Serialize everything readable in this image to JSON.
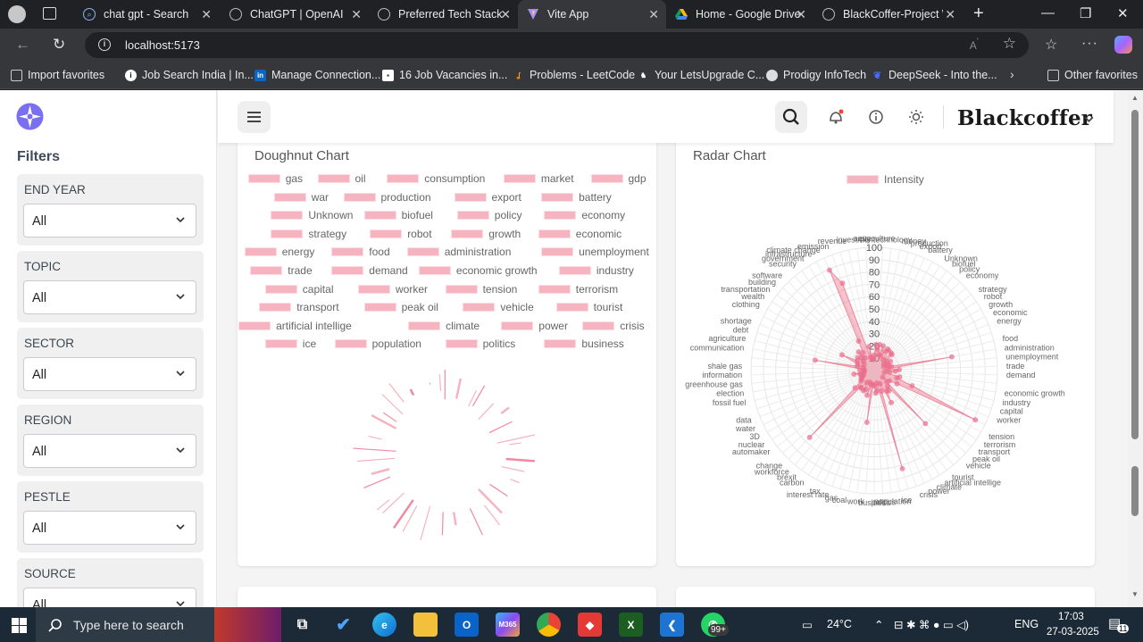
{
  "browser": {
    "tabs": [
      {
        "title": "chat gpt - Search",
        "active": false
      },
      {
        "title": "ChatGPT | OpenAI",
        "active": false
      },
      {
        "title": "Preferred Tech Stack",
        "active": false
      },
      {
        "title": "Vite App",
        "active": true
      },
      {
        "title": "Home - Google Drive",
        "active": false
      },
      {
        "title": "BlackCoffer-Project W",
        "active": false
      }
    ],
    "url": "localhost:5173",
    "favorites": [
      {
        "label": "Import favorites"
      },
      {
        "label": "Job Search India | In..."
      },
      {
        "label": "Manage Connection..."
      },
      {
        "label": "16 Job Vacancies in..."
      },
      {
        "label": "Problems - LeetCode"
      },
      {
        "label": "Your LetsUpgrade C..."
      },
      {
        "label": "Prodigy InfoTech"
      },
      {
        "label": "DeepSeek - Into the..."
      },
      {
        "label": "Other favorites"
      }
    ]
  },
  "sidebar": {
    "title": "Filters",
    "filters": [
      {
        "label": "END YEAR",
        "value": "All"
      },
      {
        "label": "TOPIC",
        "value": "All"
      },
      {
        "label": "SECTOR",
        "value": "All"
      },
      {
        "label": "REGION",
        "value": "All"
      },
      {
        "label": "PESTLE",
        "value": "All"
      },
      {
        "label": "SOURCE",
        "value": "All"
      }
    ]
  },
  "header": {
    "brand": "Blackcoffer"
  },
  "colors": {
    "accent": "#f6b3c0",
    "accent_stroke": "#e8778f",
    "logo": "#7a6ff0"
  },
  "chart_data": [
    {
      "type": "pie",
      "title": "Doughnut Chart",
      "categories": [
        "gas",
        "oil",
        "consumption",
        "market",
        "gdp",
        "war",
        "production",
        "export",
        "battery",
        "Unknown",
        "biofuel",
        "policy",
        "economy",
        "strategy",
        "robot",
        "growth",
        "economic",
        "energy",
        "food",
        "administration",
        "unemployment",
        "trade",
        "demand",
        "economic growth",
        "industry",
        "capital",
        "worker",
        "tension",
        "terrorism",
        "transport",
        "peak oil",
        "vehicle",
        "tourist",
        "artificial intellige",
        "climate",
        "power",
        "crisis",
        "ice",
        "population",
        "politics",
        "business"
      ],
      "legend_position": "top"
    },
    {
      "type": "radar",
      "title": "Radar Chart",
      "series": [
        {
          "name": "Intensity"
        }
      ],
      "r_ticks": [
        "100",
        "90",
        "80",
        "70",
        "60",
        "50",
        "40",
        "30",
        "20",
        "10"
      ],
      "r_range": [
        0,
        100
      ],
      "axis_labels": [
        "production",
        "export",
        "battery",
        "Unknown",
        "biofuel",
        "policy",
        "economy",
        "strategy",
        "robot",
        "growth",
        "economic",
        "energy",
        "food",
        "administration",
        "unemployment",
        "trade",
        "demand",
        "economic growth",
        "industry",
        "capital",
        "worker",
        "tension",
        "terrorism",
        "transport",
        "peak oil",
        "vehicle",
        "tourist",
        "artificial intellige",
        "climate",
        "power",
        "crisis",
        "ice",
        "population",
        "politics",
        "business",
        "work",
        "coal",
        "gas",
        "interest rate",
        "tax",
        "carbon",
        "brexit",
        "workforce",
        "change",
        "automaker",
        "nuclear",
        "3D",
        "water",
        "data",
        "fossil fuel",
        "election",
        "greenhouse gas",
        "information",
        "shale gas",
        "communication",
        "agriculture",
        "debt",
        "shortage",
        "clothing",
        "wealth",
        "transportation",
        "building",
        "software",
        "security",
        "government",
        "infrastructure",
        "climate change",
        "emission",
        "revenue",
        "investment",
        "city",
        "aquaculture",
        "technology",
        "money"
      ],
      "legend_position": "top"
    }
  ],
  "taskbar": {
    "search_placeholder": "Type here to search",
    "weather": "24°C",
    "language": "ENG",
    "time": "17:03",
    "date": "27-03-2025",
    "whatsapp_badge": "99+",
    "notif_count": "11"
  }
}
